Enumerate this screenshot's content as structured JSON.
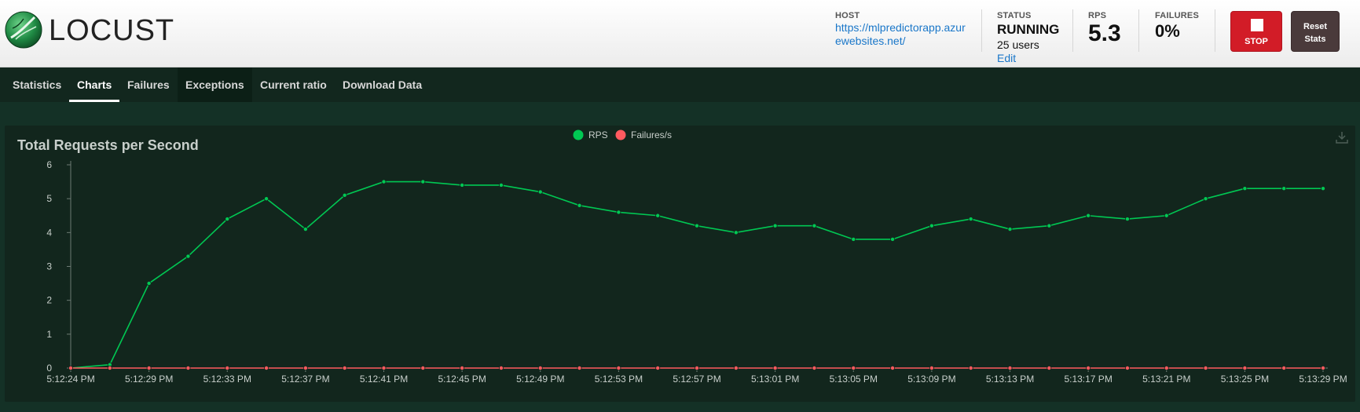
{
  "app": {
    "logo_text": "LOCUST"
  },
  "header": {
    "host": {
      "label": "HOST",
      "value": "https://mlpredictorapp.azurewebsites.net/"
    },
    "status": {
      "label": "STATUS",
      "value": "RUNNING",
      "users": "25 users",
      "edit": "Edit"
    },
    "rps": {
      "label": "RPS",
      "value": "5.3"
    },
    "failures": {
      "label": "FAILURES",
      "value": "0%"
    },
    "stop_label": "STOP",
    "reset_label_line1": "Reset",
    "reset_label_line2": "Stats"
  },
  "nav": {
    "tabs": [
      {
        "label": "Statistics"
      },
      {
        "label": "Charts"
      },
      {
        "label": "Failures"
      },
      {
        "label": "Exceptions"
      },
      {
        "label": "Current ratio"
      },
      {
        "label": "Download Data"
      }
    ],
    "active": "Charts"
  },
  "colors": {
    "rps": "#00c853",
    "failures": "#ff5a5f",
    "axis": "#888888",
    "text": "#c8cfcb"
  },
  "chart_data": {
    "type": "line",
    "title": "Total Requests per Second",
    "legend": [
      "RPS",
      "Failures/s"
    ],
    "legend_position": "top-center",
    "x": [
      "5:12:24 PM",
      "5:12:26 PM",
      "5:12:28 PM",
      "5:12:30 PM",
      "5:12:32 PM",
      "5:12:34 PM",
      "5:12:36 PM",
      "5:12:38 PM",
      "5:12:40 PM",
      "5:12:42 PM",
      "5:12:44 PM",
      "5:12:46 PM",
      "5:12:48 PM",
      "5:12:50 PM",
      "5:12:52 PM",
      "5:12:54 PM",
      "5:12:56 PM",
      "5:12:58 PM",
      "5:13:00 PM",
      "5:13:02 PM",
      "5:13:04 PM",
      "5:13:06 PM",
      "5:13:08 PM",
      "5:13:10 PM",
      "5:13:12 PM",
      "5:13:14 PM",
      "5:13:16 PM",
      "5:13:18 PM",
      "5:13:20 PM",
      "5:13:22 PM",
      "5:13:24 PM",
      "5:13:26 PM",
      "5:13:28 PM",
      "5:13:30 PM"
    ],
    "x_tick_labels": [
      "5:12:24 PM",
      "5:12:29 PM",
      "5:12:33 PM",
      "5:12:37 PM",
      "5:12:41 PM",
      "5:12:45 PM",
      "5:12:49 PM",
      "5:12:53 PM",
      "5:12:57 PM",
      "5:13:01 PM",
      "5:13:05 PM",
      "5:13:09 PM",
      "5:13:13 PM",
      "5:13:17 PM",
      "5:13:21 PM",
      "5:13:25 PM",
      "5:13:29 PM"
    ],
    "series": [
      {
        "name": "RPS",
        "color": "#00c853",
        "values": [
          0,
          0.1,
          2.5,
          3.3,
          4.4,
          5.0,
          4.1,
          5.1,
          5.5,
          5.5,
          5.4,
          5.4,
          5.2,
          4.8,
          4.6,
          4.5,
          4.2,
          4.0,
          4.2,
          4.2,
          3.8,
          3.8,
          4.2,
          4.4,
          4.1,
          4.2,
          4.5,
          4.4,
          4.5,
          5.0,
          5.3,
          5.3,
          5.3
        ]
      },
      {
        "name": "Failures/s",
        "color": "#ff5a5f",
        "values": [
          0,
          0,
          0,
          0,
          0,
          0,
          0,
          0,
          0,
          0,
          0,
          0,
          0,
          0,
          0,
          0,
          0,
          0,
          0,
          0,
          0,
          0,
          0,
          0,
          0,
          0,
          0,
          0,
          0,
          0,
          0,
          0,
          0
        ]
      }
    ],
    "y_ticks": [
      0,
      1,
      2,
      3,
      4,
      5,
      6
    ],
    "ylim": [
      0,
      6
    ],
    "grid": false
  }
}
